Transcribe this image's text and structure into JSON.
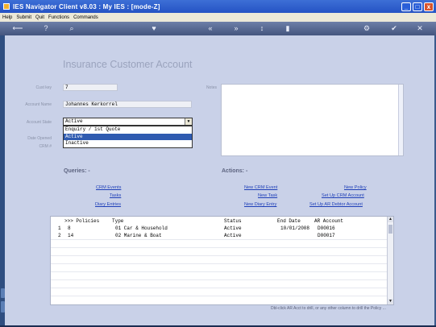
{
  "window": {
    "title": "IES Navigator Client v8.03 : My IES :      [mode-Z]",
    "buttons": {
      "minimize": "_",
      "maximize": "□",
      "close": "x"
    }
  },
  "menu": [
    "Help",
    "Submit",
    "Quit",
    "Functions",
    "Commands"
  ],
  "toolbar": {
    "back": "⟵",
    "help": "?",
    "search": "⌕",
    "heart": "♥",
    "prev": "«",
    "next": "»",
    "nav1": "↕",
    "nav2": "▮",
    "settings": "⚙",
    "ok": "✔",
    "close": "✕"
  },
  "page": {
    "title": "Insurance Customer Account"
  },
  "form": {
    "cust_key_label": "Cust key",
    "cust_key_value": "7",
    "account_name_label": "Account Name",
    "account_name_value": "Johannes Kerkorrel",
    "account_state_label": "Account State",
    "account_state_value": "Active",
    "state_options": [
      "Enquiry / 1st Quote",
      "Active",
      "Inactive"
    ],
    "selected_option_index": 1,
    "date_opened_label": "Date Opened",
    "crm_label": "CRM #",
    "notes_label": "Notes"
  },
  "queries": {
    "heading": "Queries: -",
    "links": [
      "CRM Events",
      "Tasks",
      "Diary Entries"
    ]
  },
  "actions": {
    "heading": "Actions: -",
    "col1": [
      "New CRM Event",
      "New Task",
      "New Diary Entry"
    ],
    "col2": [
      "New Policy",
      "Set Up CRM Account",
      "Set Up AR Debtor Account"
    ]
  },
  "grid": {
    "headers": [
      ">>> Policies",
      "Type",
      "Status",
      "End Date",
      "AR Account"
    ],
    "rows": [
      {
        "num": "1",
        "policy": "8",
        "type": "01 Car & Household",
        "status": "Active",
        "end_date": "10/01/2008",
        "ar_account": "D00016"
      },
      {
        "num": "2",
        "policy": "14",
        "type": "02 Marine & Boat",
        "status": "Active",
        "end_date": "",
        "ar_account": "D00017"
      }
    ],
    "scroll_up": "▲",
    "scroll_down": "▼"
  },
  "hint": "Dbl-click AR Acct to drill, or any other column  to drill the Policy ...",
  "colors": {
    "accent": "#2f5bb0",
    "link": "#1e3fb8",
    "background": "#c9d1e8",
    "titlebar": "#2553c4"
  }
}
